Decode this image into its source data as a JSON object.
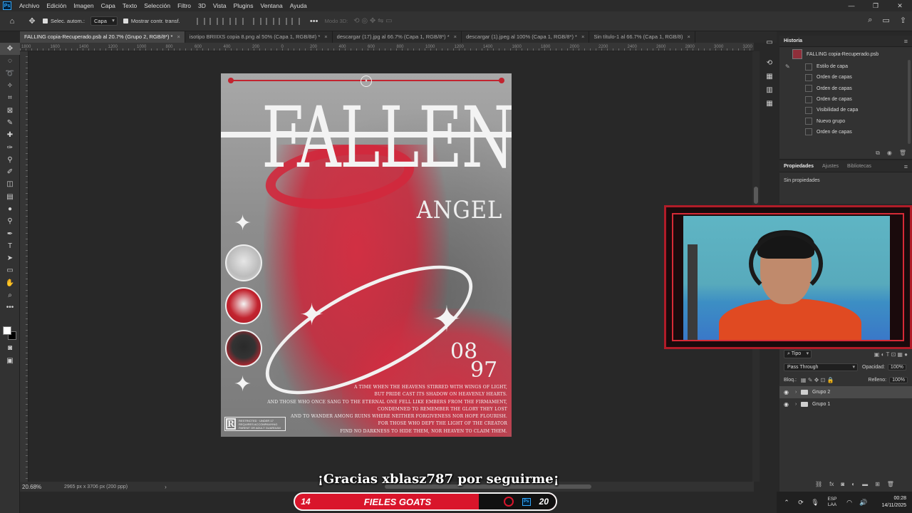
{
  "menubar": {
    "items": [
      "Archivo",
      "Edición",
      "Imagen",
      "Capa",
      "Texto",
      "Selección",
      "Filtro",
      "3D",
      "Vista",
      "Plugins",
      "Ventana",
      "Ayuda"
    ]
  },
  "options": {
    "auto_select_label": "Selec. autom.:",
    "auto_select_target": "Capa",
    "show_transform_label": "Mostrar contr. transf.",
    "mode3d_label": "Modo 3D:"
  },
  "tabs": [
    {
      "label": "FALLING copia-Recuperado.psb al 20.7% (Grupo 2, RGB/8*) *",
      "active": true
    },
    {
      "label": "isotipo BRIIIXS copia 8.png al 50% (Capa 1, RGB/8#) *",
      "active": false
    },
    {
      "label": "descargar (17).jpg al 66.7% (Capa 1, RGB/8*) *",
      "active": false
    },
    {
      "label": "descargar (1).jpeg al 100% (Capa 1, RGB/8*) *",
      "active": false
    },
    {
      "label": "Sin título-1 al 66.7% (Capa 1, RGB/8)",
      "active": false
    }
  ],
  "ruler_h": [
    "1800",
    "1600",
    "1400",
    "1200",
    "1000",
    "800",
    "600",
    "400",
    "200",
    "0",
    "200",
    "400",
    "600",
    "800",
    "1000",
    "1200",
    "1400",
    "1600",
    "1800",
    "2000",
    "2200",
    "2400",
    "2600",
    "2800",
    "3000",
    "3200",
    "3400",
    "3600",
    "3800",
    "4000",
    "4200",
    "4400",
    "4600",
    "4800",
    "5000"
  ],
  "poster": {
    "title": "FALLEN",
    "subtitle": "ANGEL",
    "date_top": "08",
    "date_bottom": "97",
    "logo": "ꟷ",
    "rating_letter": "R",
    "rating_text": "RESTRICTED · UNDER 17 REQUIRES ACCOMPANYING PARENT OR ADULT GUARDIAN",
    "text_lines": [
      "A TIME WHEN THE HEAVENS STIRRED WITH WINGS OF LIGHT,",
      "BUT PRIDE CAST ITS SHADOW ON HEAVENLY HEARTS.",
      "AND THOSE WHO ONCE SANG TO THE ETERNAL ONE FELL LIKE EMBERS FROM THE FIRMAMENT,",
      "CONDEMNED TO REMEMBER THE GLORY THEY LOST",
      "AND TO WANDER AMONG RUINS WHERE NEITHER FORGIVENESS NOR HOPE FLOURISH.",
      "FOR THOSE WHO DEFY THE LIGHT OF THE CREATOR",
      "FIND NO DARKNESS TO HIDE THEM, NOR HEAVEN TO CLAIM THEM."
    ]
  },
  "history": {
    "tab": "Historia",
    "snapshot": "FALLING copia-Recuperado.psb",
    "items": [
      "Estilo de capa",
      "Orden de capas",
      "Orden de capas",
      "Orden de capas",
      "Visibilidad de capa",
      "Nuevo grupo",
      "Orden de capas"
    ]
  },
  "properties": {
    "tabs": [
      "Propiedades",
      "Ajustes",
      "Bibliotecas"
    ],
    "empty": "Sin propiedades"
  },
  "layers": {
    "filter_label": "Tipo",
    "blend_mode": "Pass Through",
    "opacity_label": "Opacidad:",
    "opacity_value": "100%",
    "lock_label": "Bloq.:",
    "fill_label": "Relleno:",
    "fill_value": "100%",
    "items": [
      {
        "name": "Grupo 2",
        "selected": true
      },
      {
        "name": "Grupo 1",
        "selected": false
      }
    ]
  },
  "status": {
    "zoom": "20.68%",
    "doc_size": "2965 px x 3706 px (200 ppp)"
  },
  "overlay": {
    "thanks": "¡Gracias xblasz787 por seguirme¡",
    "bar_left": "14",
    "bar_title": "FIELES GOATS",
    "bar_right": "20"
  },
  "tray": {
    "lang_1": "ESP",
    "lang_2": "LAA",
    "time": "00:28",
    "date": "14/11/2025"
  }
}
